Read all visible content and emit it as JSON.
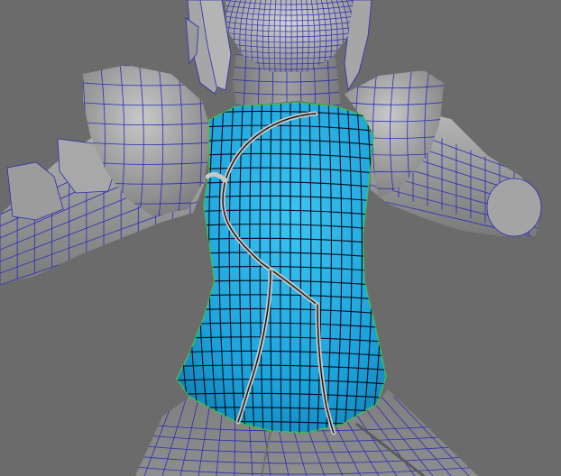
{
  "viewport": {
    "background": "#6b6b6b",
    "mesh_fill": "#8a8a8a",
    "mesh_shade": "#6f6f6f",
    "mesh_light": "#b5b5b5",
    "wire_color": "#2b2bb8",
    "selected_fill": "#1fa9e0",
    "selected_fill_dark": "#1586b8",
    "selected_wire": "#0a0a1a",
    "selection_outline": "#3cc05a",
    "seam_color": "#c8c8c8"
  }
}
